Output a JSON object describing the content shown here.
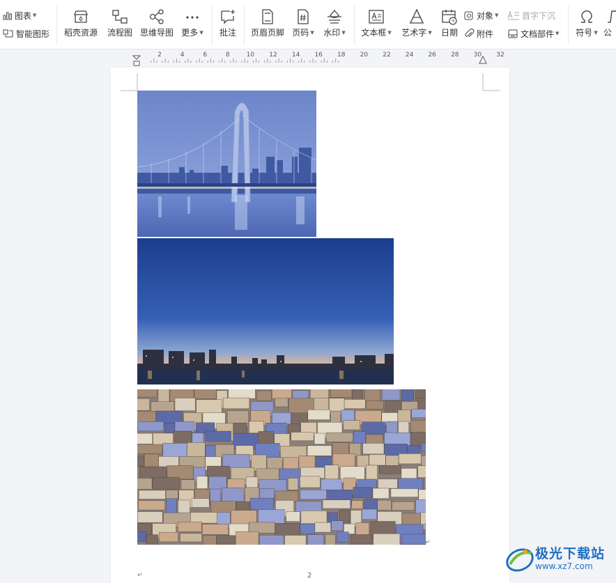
{
  "toolbar": {
    "chart": "图表",
    "smart_shape": "智能图形",
    "docer": "稻壳资源",
    "flowchart": "流程图",
    "mindmap": "思维导图",
    "more": "更多",
    "comment": "批注",
    "header_footer": "页眉页脚",
    "page_number": "页码",
    "watermark": "水印",
    "textbox": "文本框",
    "wordart": "艺术字",
    "date": "日期",
    "object": "对象",
    "attachment": "附件",
    "drop_cap": "首字下沉",
    "doc_parts": "文档部件",
    "symbol": "符号",
    "formula": "公"
  },
  "ruler": {
    "ticks": [
      "2",
      "4",
      "6",
      "8",
      "10",
      "12",
      "14",
      "16",
      "18",
      "20",
      "22",
      "24",
      "26",
      "28",
      "30",
      "32"
    ]
  },
  "document": {
    "images": [
      {
        "subject": "suspension bridge over river at dusk"
      },
      {
        "subject": "city skyline at twilight reflected in water"
      },
      {
        "subject": "aerial view of dense colorful city buildings"
      }
    ],
    "paragraph_mark": "↵",
    "page_number": "2"
  },
  "watermark_logo": {
    "name": "极光下载站",
    "url": "www.xz7.com"
  },
  "colors": {
    "accent": "#1f6fc4",
    "toolbar_bg": "#ffffff",
    "workspace_bg": "#f3f4f7"
  }
}
